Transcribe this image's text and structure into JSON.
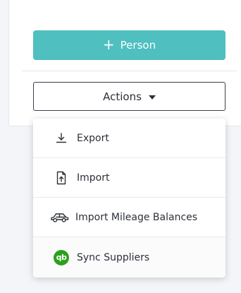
{
  "primary_button": {
    "label": "Person",
    "icon": "plus-icon"
  },
  "actions_button": {
    "label": "Actions",
    "icon": "caret-down-icon"
  },
  "actions_menu": {
    "items": [
      {
        "label": "Export",
        "icon": "download-icon"
      },
      {
        "label": "Import",
        "icon": "file-upload-icon"
      },
      {
        "label": "Import Mileage Balances",
        "icon": "car-icon"
      },
      {
        "label": "Sync Suppliers",
        "icon": "quickbooks-logo-icon"
      }
    ]
  },
  "colors": {
    "primary": "#4fbfbf",
    "quickbooks_green": "#2ca01c",
    "text": "#2c3038"
  }
}
